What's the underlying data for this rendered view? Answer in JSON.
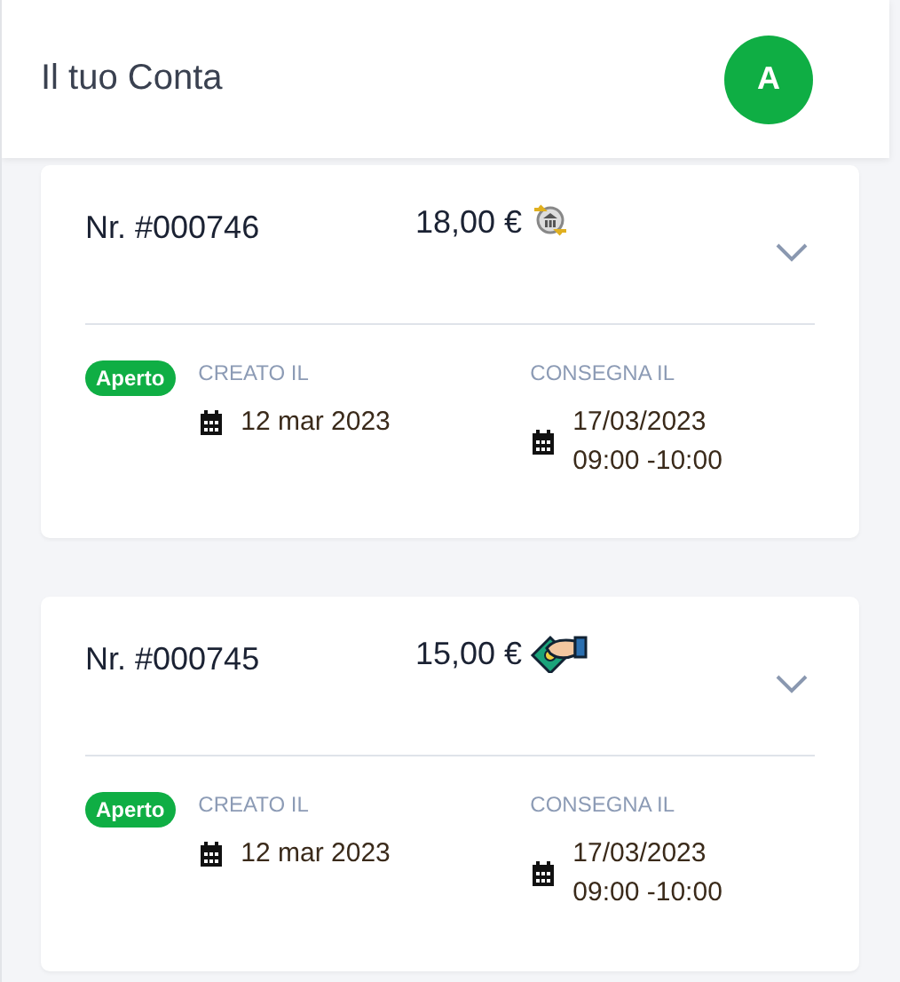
{
  "header": {
    "title": "Il tuo Conta",
    "avatar": "A"
  },
  "orders": [
    {
      "number": "Nr. #000746",
      "amount": "18,00 €",
      "payment": {
        "kind": "bank_transfer"
      },
      "status": "Aperto",
      "created_label": "CREATO IL",
      "created": "12 mar 2023",
      "delivery_label": "CONSEGNA IL",
      "delivery_date": "17/03/2023",
      "delivery_time": "09:00 -10:00"
    },
    {
      "number": "Nr. #000745",
      "amount": "15,00 €",
      "payment": {
        "kind": "cash"
      },
      "status": "Aperto",
      "created_label": "CREATO IL",
      "created": "12 mar 2023",
      "delivery_label": "CONSEGNA IL",
      "delivery_date": "17/03/2023",
      "delivery_time": "09:00 -10:00"
    }
  ]
}
